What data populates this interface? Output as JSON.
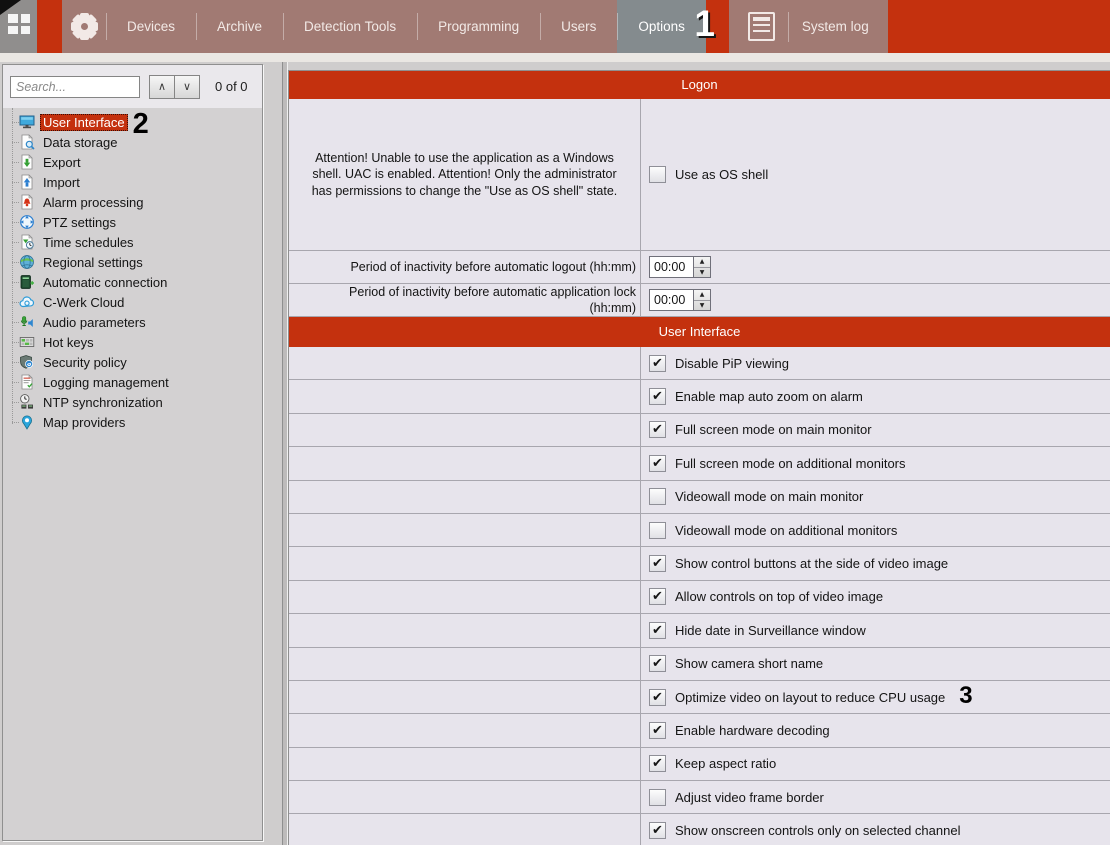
{
  "topbar": {
    "tabs": [
      "Devices",
      "Archive",
      "Detection Tools",
      "Programming",
      "Users",
      "Options"
    ],
    "selected_tab": "Options",
    "system_log": {
      "label": "System log",
      "icon": "report-icon"
    },
    "gear_icon": "settings-gear-icon",
    "launcher_icon": "app-launcher-grid-icon"
  },
  "annotations": {
    "step_1": "1",
    "step_2": "2",
    "step_3": "3"
  },
  "sidebar": {
    "search_placeholder": "Search...",
    "up_button_glyph": "∧",
    "down_button_glyph": "∨",
    "result_counter": "0 of 0",
    "items": [
      {
        "label": "User Interface",
        "icon": "monitor-icon",
        "selected": true
      },
      {
        "label": "Data storage",
        "icon": "data-storage-icon"
      },
      {
        "label": "Export",
        "icon": "export-icon"
      },
      {
        "label": "Import",
        "icon": "import-icon"
      },
      {
        "label": "Alarm processing",
        "icon": "alarm-icon"
      },
      {
        "label": "PTZ settings",
        "icon": "ptz-icon"
      },
      {
        "label": "Time schedules",
        "icon": "schedule-icon"
      },
      {
        "label": "Regional settings",
        "icon": "globe-icon"
      },
      {
        "label": "Automatic connection",
        "icon": "connection-icon"
      },
      {
        "label": "C-Werk Cloud",
        "icon": "cloud-icon"
      },
      {
        "label": "Audio parameters",
        "icon": "audio-icon"
      },
      {
        "label": "Hot keys",
        "icon": "hotkeys-icon"
      },
      {
        "label": "Security policy",
        "icon": "shield-icon"
      },
      {
        "label": "Logging management",
        "icon": "logging-icon"
      },
      {
        "label": "NTP synchronization",
        "icon": "ntp-icon"
      },
      {
        "label": "Map providers",
        "icon": "map-pin-icon"
      }
    ]
  },
  "main": {
    "logon_section": {
      "title": "Logon",
      "attention_text": "Attention! Unable to use the application as a Windows shell. UAC is enabled. Attention! Only the administrator has permissions to change the \"Use as OS shell\" state.",
      "os_shell_label": "Use as OS shell",
      "os_shell_checked": false,
      "spin_rows": [
        {
          "label": "Period of inactivity before automatic logout (hh:mm)",
          "value": "00:00"
        },
        {
          "label": "Period of inactivity before automatic application lock (hh:mm)",
          "value": "00:00"
        }
      ],
      "spin_up_glyph": "▲",
      "spin_down_glyph": "▼"
    },
    "ui_section": {
      "title": "User Interface",
      "check_glyph": "✔",
      "checkboxes": [
        {
          "label": "Disable PiP viewing",
          "checked": true
        },
        {
          "label": "Enable map auto zoom on alarm",
          "checked": true
        },
        {
          "label": "Full screen mode on main monitor",
          "checked": true
        },
        {
          "label": "Full screen mode on additional monitors",
          "checked": true
        },
        {
          "label": "Videowall mode on main monitor",
          "checked": false
        },
        {
          "label": "Videowall mode on additional monitors",
          "checked": false
        },
        {
          "label": "Show control buttons at the side of video image",
          "checked": true
        },
        {
          "label": "Allow controls on top of video image",
          "checked": true
        },
        {
          "label": "Hide date in Surveillance window",
          "checked": true
        },
        {
          "label": "Show camera short name",
          "checked": true
        },
        {
          "label": "Optimize video on layout to reduce CPU usage",
          "checked": true,
          "annotation": "3"
        },
        {
          "label": "Enable hardware decoding",
          "checked": true
        },
        {
          "label": "Keep aspect ratio",
          "checked": true
        },
        {
          "label": "Adjust video frame border",
          "checked": false
        },
        {
          "label": "Show onscreen controls only on selected channel",
          "checked": true
        }
      ]
    }
  },
  "colors": {
    "accent_red": "#c4310e",
    "tab_bar": "#a17a73",
    "selected_tab": "#848b8e",
    "panel_bg": "#e7e4ec",
    "sidebar_bg": "#d3d1d2",
    "grid_line": "#a8a6ae"
  }
}
